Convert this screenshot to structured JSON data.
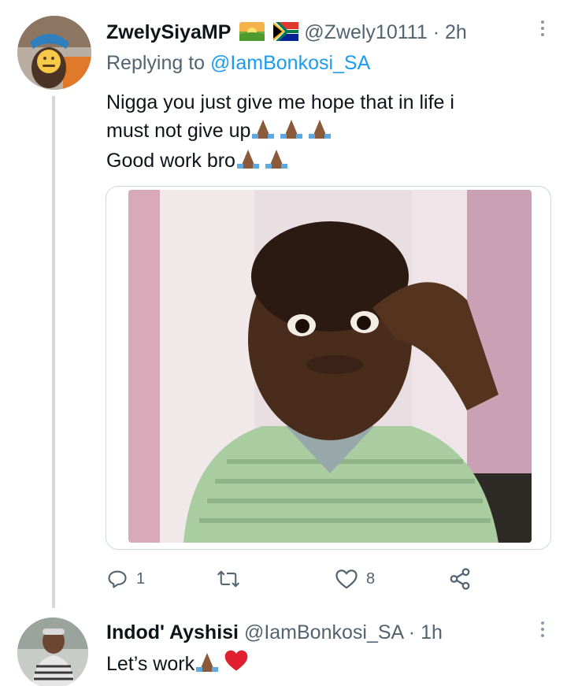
{
  "tweets": [
    {
      "display_name": "ZwelySiyaMP",
      "handle": "@Zwely10111",
      "separator": "·",
      "time": "2h",
      "replying_prefix": "Replying to ",
      "replying_to": "@IamBonkosi_SA",
      "text_lines": [
        "Nigga you just give me hope that in life i",
        "must not give up",
        "Good work bro"
      ],
      "reply_count": "1",
      "retweet_count": "",
      "like_count": "8"
    },
    {
      "display_name": "Indod' Ayshisi",
      "handle": "@IamBonkosi_SA",
      "separator": "·",
      "time": "1h",
      "text_lines": [
        "Let’s work"
      ]
    }
  ],
  "icons": {
    "flag_sunrise": "sunrise-emoji-icon",
    "flag_za": "south-africa-flag-icon",
    "pray": "folded-hands-icon",
    "heart": "red-heart-icon",
    "reply": "reply-icon",
    "retweet": "retweet-icon",
    "like": "like-icon",
    "share": "share-icon",
    "more": "more-icon"
  },
  "colors": {
    "text": "#0f1419",
    "secondary": "#536471",
    "link": "#1d9bf0",
    "border": "#cfd9de"
  }
}
